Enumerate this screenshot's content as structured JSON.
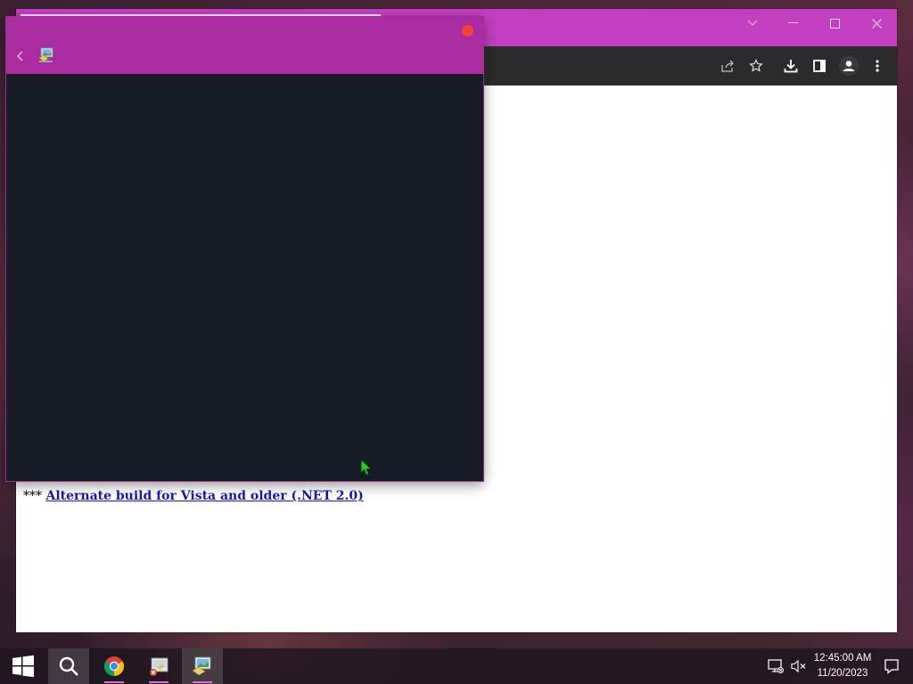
{
  "browser": {
    "window_controls": {
      "chevron": "chevron-down-icon",
      "minimize": "minimize-icon",
      "maximize": "maximize-icon",
      "close": "close-icon"
    },
    "toolbar_icons": [
      "share-icon",
      "star-icon",
      "download-icon",
      "side-panel-icon",
      "profile-icon",
      "menu-dots-icon"
    ],
    "content": {
      "prefix": "***",
      "link_text": "Alternate build for Vista and older (.NET 2.0)"
    }
  },
  "overlay": {
    "header_color": "#ab2ca0",
    "close_color": "#f2433a",
    "body_color": "#171b26",
    "icons": [
      "back-arrow-icon",
      "app-icon"
    ]
  },
  "taskbar": {
    "items": [
      "windows-start-icon",
      "search-icon",
      "chrome-icon",
      "installer-app-icon",
      "image-app-icon"
    ],
    "tray_icons": [
      "network-icon",
      "volume-muted-icon",
      "notifications-icon"
    ],
    "clock": {
      "time": "12:45:00 AM",
      "date": "11/20/2023"
    }
  }
}
